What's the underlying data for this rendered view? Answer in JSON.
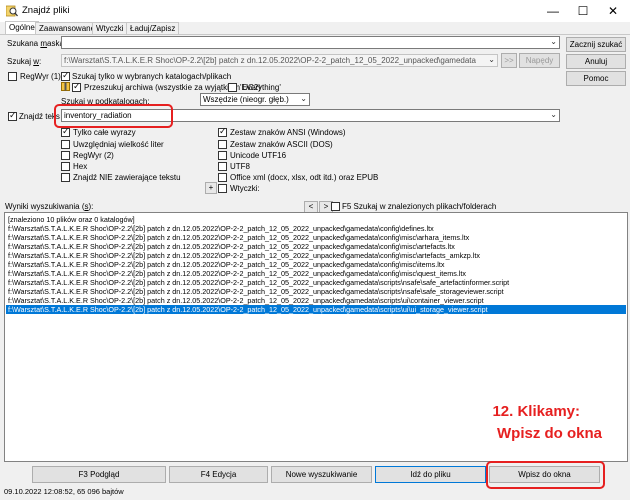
{
  "window": {
    "title": "Znajdź pliki",
    "minimize_glyph": "—",
    "maximize_glyph": "☐",
    "close_glyph": "✕"
  },
  "tabs": [
    "Ogólne",
    "Zaawansowane",
    "Wtyczki",
    "Ładuj/Zapisz"
  ],
  "search": {
    "search_for_label": "Szukana ",
    "search_for_label_u": "m",
    "search_for_label_tail": "aska:",
    "search_for_value": "",
    "search_in_label": "Szukaj ",
    "search_in_label_u": "w",
    "search_in_label_tail": ":",
    "search_in_value": "f:\\Warsztat\\S.T.A.L.K.E.R Shoc\\OP-2.2\\[2b] patch z dn.12.05.2022\\OP-2-2_patch_12_05_2022_unpacked\\gamedata",
    "nav_button": ">>",
    "drives_button": "Napędy",
    "regwyr_label": "RegWyr (1)",
    "only_selected_label": "Szukaj tylko w wybranych katalogach/plikach",
    "archives_label": "Przeszukuj archiwa (wszystkie za wyjątkiem UC2)",
    "everything_label": "'Everything'",
    "subdirs_label": "Szukaj w podkatalogach:",
    "subdirs_value": "Wszędzie (nieogr. głęb.)"
  },
  "text_search": {
    "find_text_label": "Znajdź teks",
    "find_text_value": "inventory_radiation",
    "options_left": [
      "Tylko całe wyrazy",
      "Uwzględniaj wielkość liter",
      "RegWyr (2)",
      "Hex",
      "Znajdź NIE zawierające tekstu"
    ],
    "options_right": [
      "Zestaw znaków ANSI (Windows)",
      "Zestaw znaków ASCII (DOS)",
      "Unicode UTF16",
      "UTF8",
      "Office xml (docx, xlsx, odt itd.) oraz EPUB",
      "Wtyczki:"
    ],
    "plus_button": "+"
  },
  "side_buttons": {
    "start": "Zacznij szukać",
    "cancel": "Anuluj",
    "help": "Pomoc"
  },
  "results": {
    "header_label": "Wyniki wyszukiwania (",
    "header_label_u": "s",
    "header_label_tail": "):",
    "prev_button": "<",
    "next_button": ">",
    "search_in_found_label": "F5 Szukaj w znalezionych plikach/folderach",
    "summary": "[znaleziono 10 plików oraz 0 katalogów]",
    "items": [
      "f:\\Warsztat\\S.T.A.L.K.E.R Shoc\\OP-2.2\\[2b] patch z dn.12.05.2022\\OP-2-2_patch_12_05_2022_unpacked\\gamedata\\config\\defines.ltx",
      "f:\\Warsztat\\S.T.A.L.K.E.R Shoc\\OP-2.2\\[2b] patch z dn.12.05.2022\\OP-2-2_patch_12_05_2022_unpacked\\gamedata\\config\\misc\\arhara_items.ltx",
      "f:\\Warsztat\\S.T.A.L.K.E.R Shoc\\OP-2.2\\[2b] patch z dn.12.05.2022\\OP-2-2_patch_12_05_2022_unpacked\\gamedata\\config\\misc\\artefacts.ltx",
      "f:\\Warsztat\\S.T.A.L.K.E.R Shoc\\OP-2.2\\[2b] patch z dn.12.05.2022\\OP-2-2_patch_12_05_2022_unpacked\\gamedata\\config\\misc\\artefacts_amkzp.ltx",
      "f:\\Warsztat\\S.T.A.L.K.E.R Shoc\\OP-2.2\\[2b] patch z dn.12.05.2022\\OP-2-2_patch_12_05_2022_unpacked\\gamedata\\config\\misc\\items.ltx",
      "f:\\Warsztat\\S.T.A.L.K.E.R Shoc\\OP-2.2\\[2b] patch z dn.12.05.2022\\OP-2-2_patch_12_05_2022_unpacked\\gamedata\\config\\misc\\quest_items.ltx",
      "f:\\Warsztat\\S.T.A.L.K.E.R Shoc\\OP-2.2\\[2b] patch z dn.12.05.2022\\OP-2-2_patch_12_05_2022_unpacked\\gamedata\\scripts\\nsafe\\safe_artefactinformer.script",
      "f:\\Warsztat\\S.T.A.L.K.E.R Shoc\\OP-2.2\\[2b] patch z dn.12.05.2022\\OP-2-2_patch_12_05_2022_unpacked\\gamedata\\scripts\\nsafe\\safe_storageviewer.script",
      "f:\\Warsztat\\S.T.A.L.K.E.R Shoc\\OP-2.2\\[2b] patch z dn.12.05.2022\\OP-2-2_patch_12_05_2022_unpacked\\gamedata\\scripts\\ui\\container_viewer.script",
      "f:\\Warsztat\\S.T.A.L.K.E.R Shoc\\OP-2.2\\[2b] patch z dn.12.05.2022\\OP-2-2_patch_12_05_2022_unpacked\\gamedata\\scripts\\ui\\ui_storage_viewer.script"
    ],
    "selected_index": 9
  },
  "bottom_buttons": [
    "F3 Podgląd",
    "F4 Edycja",
    "Nowe wyszukiwanie",
    "Idź do pliku",
    "Wpisz do okna"
  ],
  "status": "09.10.2022 12:08:52, 65 096 bajtów",
  "annotation": {
    "line1": "12. Klikamy:",
    "line2": "Wpisz do okna",
    "color": "#e62020"
  },
  "colors": {
    "selection": "#0078d7",
    "annotation_red": "#e62020"
  }
}
